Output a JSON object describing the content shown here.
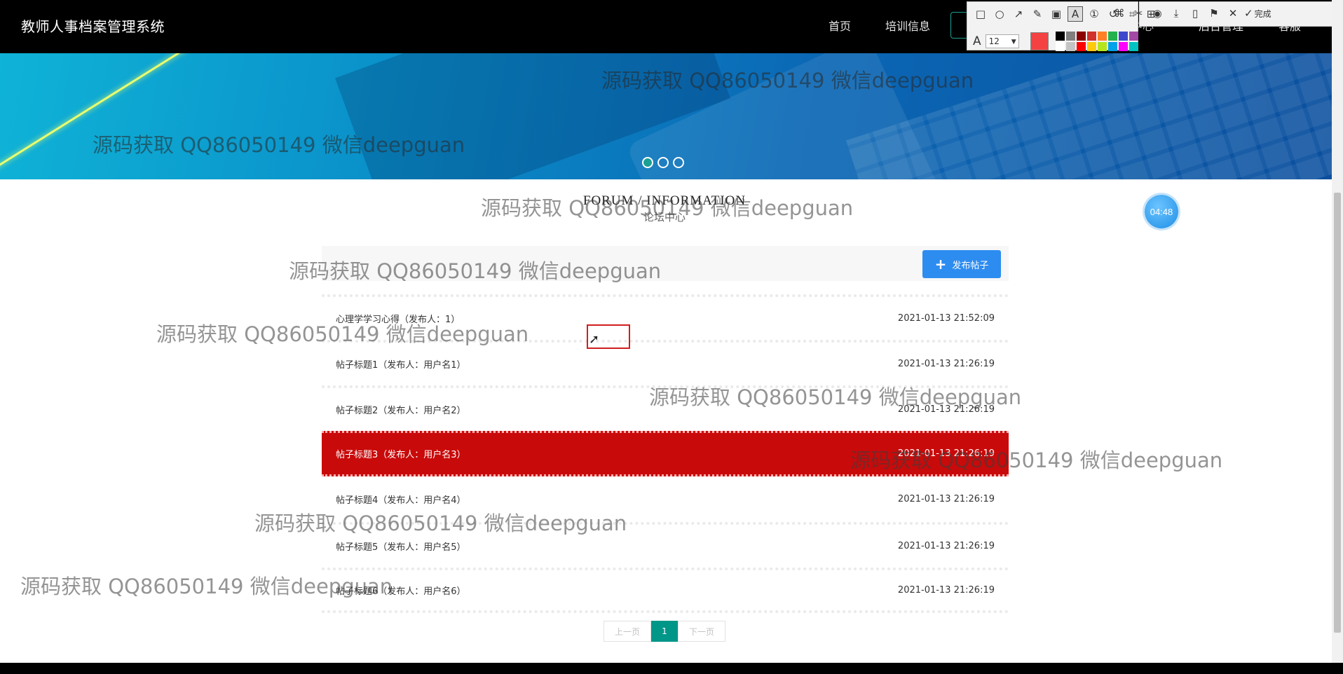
{
  "header": {
    "title": "教师人事档案管理系统",
    "nav": {
      "home": "首页",
      "training": "培训信息",
      "center_partial": "中心",
      "admin_partial": "后台管理",
      "service": "客服"
    }
  },
  "screenshot_tool": {
    "font_size": "12",
    "done_label": "完成",
    "current_color": "#f44242",
    "palette": [
      "#000000",
      "#7f7f7f",
      "#8b0000",
      "#d0312d",
      "#ff7f27",
      "#22b14c",
      "#3f48cc",
      "#a349a4",
      "#ffffff",
      "#c3c3c3",
      "#ff0000",
      "#ffc90e",
      "#b5e61d",
      "#00a2e8",
      "#ff00ff",
      "#00c2c2"
    ]
  },
  "banner": {
    "slides": 3,
    "active_slide": 1
  },
  "section": {
    "title_en": "FORUM / INFORMATION",
    "title_cn": "论坛中心"
  },
  "timer": "04:48",
  "forum": {
    "post_button": "发布帖子",
    "posts": [
      {
        "title": "心理学学习心得（发布人：1）",
        "date": "2021-01-13 21:52:09"
      },
      {
        "title": "帖子标题1（发布人：用户名1）",
        "date": "2021-01-13 21:26:19"
      },
      {
        "title": "帖子标题2（发布人：用户名2）",
        "date": "2021-01-13 21:26:19"
      },
      {
        "title": "帖子标题3（发布人：用户名3）",
        "date": "2021-01-13 21:26:19"
      },
      {
        "title": "帖子标题4（发布人：用户名4）",
        "date": "2021-01-13 21:26:19"
      },
      {
        "title": "帖子标题5（发布人：用户名5）",
        "date": "2021-01-13 21:26:19"
      },
      {
        "title": "帖子标题6（发布人：用户名6）",
        "date": "2021-01-13 21:26:19"
      }
    ],
    "highlighted_index": 3,
    "highlight_color": "#c90a0a"
  },
  "pagination": {
    "prev": "上一页",
    "current": "1",
    "next": "下一页",
    "accent": "#009688"
  },
  "watermark": "源码获取 QQ86050149 微信deepguan"
}
